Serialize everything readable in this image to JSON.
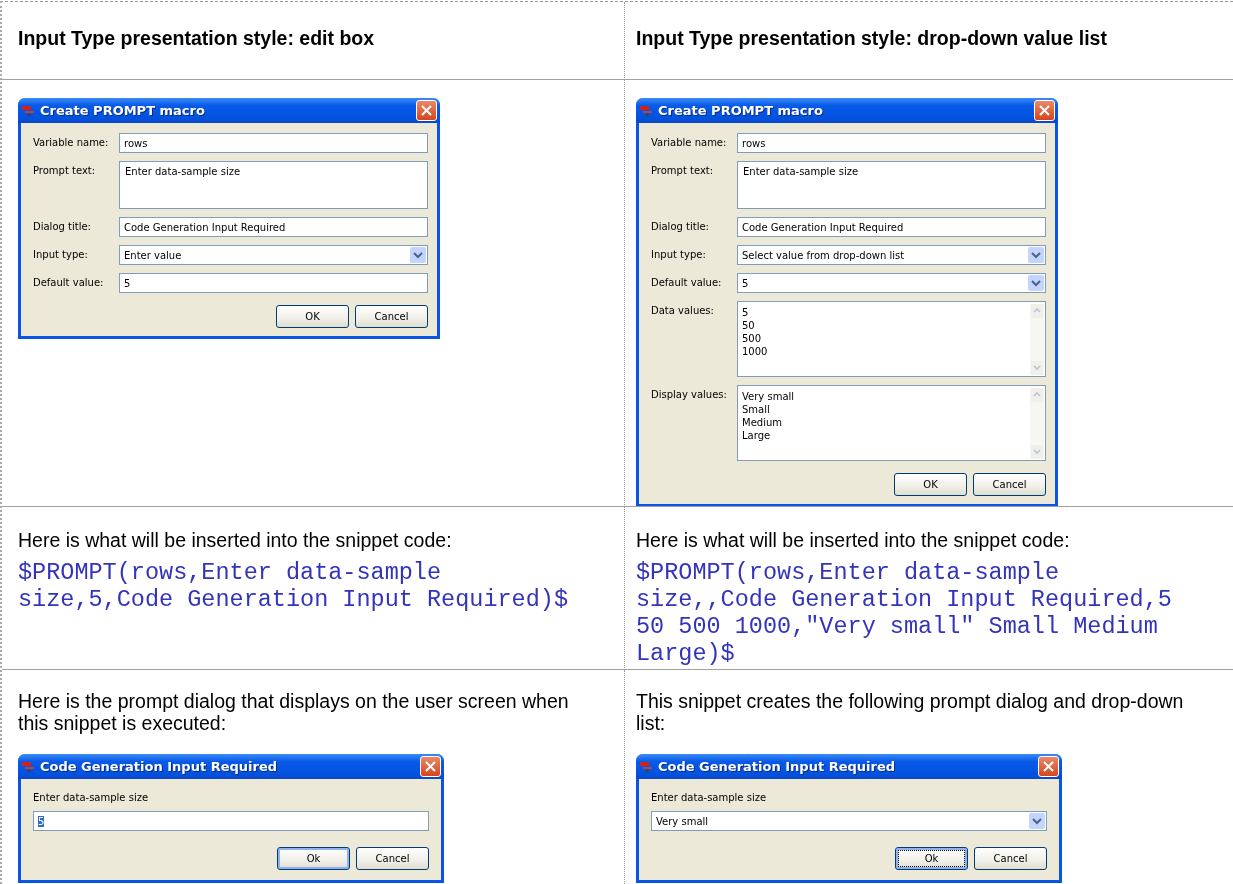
{
  "columns": [
    {
      "heading": "Input Type presentation style: edit box",
      "macro_dialog": {
        "title": "Create PROMPT macro",
        "fields": [
          {
            "kind": "text",
            "label": "Variable name:",
            "value": "rows"
          },
          {
            "kind": "textarea",
            "label": "Prompt text:",
            "value": "Enter data-sample size"
          },
          {
            "kind": "text",
            "label": "Dialog title:",
            "value": "Code Generation Input Required"
          },
          {
            "kind": "combo",
            "label": "Input type:",
            "value": "Enter value"
          },
          {
            "kind": "text",
            "label": "Default value:",
            "value": "5"
          }
        ],
        "buttons": [
          {
            "label": "OK",
            "default": false,
            "focused": false
          },
          {
            "label": "Cancel",
            "default": false,
            "focused": false
          }
        ]
      },
      "code_caption": "Here is what will be inserted into the snippet code:",
      "code": "$PROMPT(rows,Enter data-sample size,5,Code Generation Input Required)$",
      "result_caption": "Here is the prompt dialog that displays on the user screen when this snippet is executed:",
      "prompt_dialog": {
        "title": "Code Generation Input Required",
        "prompt": "Enter data-sample size",
        "field": {
          "kind": "text",
          "value": "5",
          "highlighted": true
        },
        "buttons": [
          {
            "label": "Ok",
            "default": true,
            "focused": false
          },
          {
            "label": "Cancel",
            "default": false,
            "focused": false
          }
        ]
      }
    },
    {
      "heading": "Input Type presentation style: drop-down value list",
      "macro_dialog": {
        "title": "Create PROMPT macro",
        "fields": [
          {
            "kind": "text",
            "label": "Variable name:",
            "value": "rows"
          },
          {
            "kind": "textarea",
            "label": "Prompt text:",
            "value": "Enter data-sample size"
          },
          {
            "kind": "text",
            "label": "Dialog title:",
            "value": "Code Generation Input Required"
          },
          {
            "kind": "combo",
            "label": "Input type:",
            "value": "Select value from drop-down list"
          },
          {
            "kind": "combo",
            "label": "Default value:",
            "value": "5"
          },
          {
            "kind": "list",
            "label": "Data values:",
            "lines": [
              "5",
              "50",
              "500",
              "1000"
            ]
          },
          {
            "kind": "list",
            "label": "Display values:",
            "lines": [
              "Very small",
              "Small",
              "Medium",
              "Large"
            ]
          }
        ],
        "buttons": [
          {
            "label": "OK",
            "default": false,
            "focused": false
          },
          {
            "label": "Cancel",
            "default": false,
            "focused": false
          }
        ]
      },
      "code_caption": "Here is what will be inserted into the snippet code:",
      "code": "$PROMPT(rows,Enter data-sample size,,Code Generation Input Required,5 50 500 1000,\"Very small\" Small Medium Large)$",
      "result_caption": "This snippet creates the following prompt dialog and drop-down list:",
      "prompt_dialog": {
        "title": "Code Generation Input Required",
        "prompt": "Enter data-sample size",
        "field": {
          "kind": "combo",
          "value": "Very small",
          "highlighted": false
        },
        "buttons": [
          {
            "label": "Ok",
            "default": true,
            "focused": true
          },
          {
            "label": "Cancel",
            "default": false,
            "focused": false
          }
        ]
      }
    }
  ]
}
